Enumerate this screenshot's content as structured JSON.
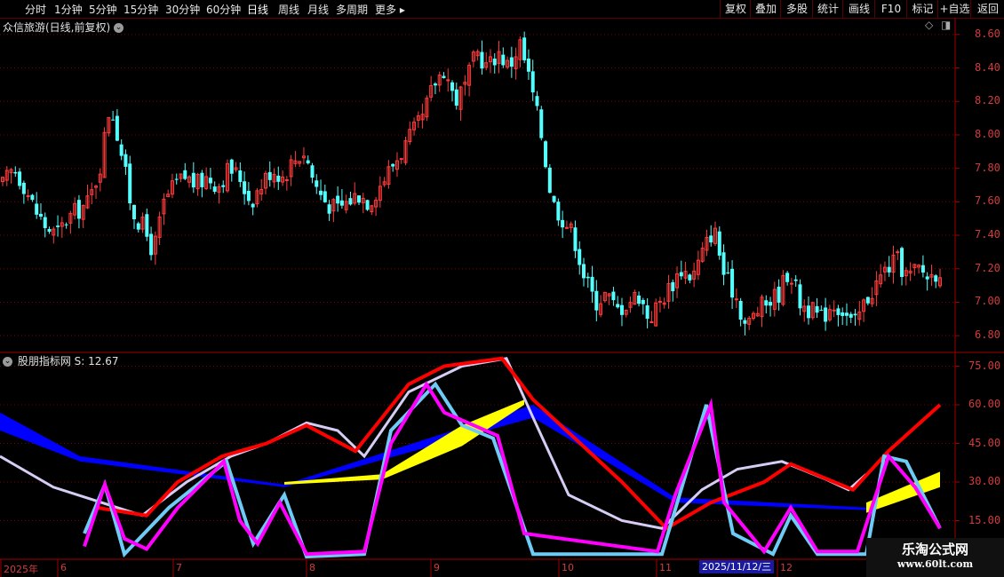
{
  "toolbar": {
    "periods": [
      "分时",
      "1分钟",
      "5分钟",
      "15分钟",
      "30分钟",
      "60分钟",
      "日线",
      "周线",
      "月线",
      "多周期",
      "更多"
    ],
    "active_period": "日线",
    "right_buttons": [
      "复权",
      "叠加",
      "多股",
      "统计",
      "画线",
      "F10",
      "标记",
      "+自选",
      "返回"
    ]
  },
  "main_panel": {
    "title": "众信旅游(日线,前复权)",
    "y_labels": [
      "8.60",
      "8.40",
      "8.20",
      "8.00",
      "7.80",
      "7.60",
      "7.40",
      "7.20",
      "7.00",
      "6.80"
    ],
    "icons": [
      "dropdown-icon",
      "diamond-icon",
      "window-toggle-icon"
    ]
  },
  "indicator_panel": {
    "title": "股朋指标网",
    "value_label": "S: 12.67",
    "y_labels": [
      "75.00",
      "60.00",
      "45.00",
      "30.00",
      "15.00"
    ]
  },
  "x_axis": {
    "labels": [
      "2025年",
      "6",
      "7",
      "8",
      "9",
      "10",
      "11",
      "12"
    ],
    "cursor_date": "2025/11/12/三"
  },
  "watermark": {
    "line1": "乐淘公式网",
    "line2": "www.60lt.com"
  },
  "colors": {
    "up": "#ff3c3c",
    "down": "#54ffff",
    "grid": "#7a0000",
    "magenta": "#ff00ff",
    "lightblue": "#6ecbf5",
    "red": "#ff0000",
    "lavender": "#d6cdf5",
    "blue": "#0000ff",
    "yellow": "#ffff00"
  },
  "chart_data": {
    "type": "candlestick",
    "price_ylim": [
      6.7,
      8.7
    ],
    "indicator_ylim": [
      0,
      80
    ],
    "close_path": [
      7.7,
      7.8,
      7.7,
      7.55,
      7.45,
      7.4,
      7.5,
      7.55,
      7.6,
      7.8,
      8.2,
      7.9,
      7.55,
      7.45,
      7.3,
      7.6,
      7.7,
      7.75,
      7.7,
      7.75,
      7.7,
      7.8,
      7.75,
      7.6,
      7.7,
      7.8,
      7.75,
      7.85,
      7.9,
      7.7,
      7.6,
      7.55,
      7.6,
      7.65,
      7.6,
      7.7,
      7.8,
      7.9,
      8.0,
      8.1,
      8.3,
      8.4,
      8.2,
      8.3,
      8.5,
      8.4,
      8.5,
      8.4,
      8.55,
      8.3,
      8.0,
      7.6,
      7.5,
      7.4,
      7.15,
      7.0,
      7.05,
      6.95,
      7.0,
      7.05,
      6.9,
      7.0,
      7.1,
      7.2,
      7.15,
      7.3,
      7.45,
      7.15,
      7.05,
      6.85,
      6.95,
      7.0,
      7.05,
      7.2,
      7.0,
      6.95,
      6.9,
      7.0,
      6.95,
      6.85,
      7.0,
      7.1,
      7.2,
      7.25,
      7.15,
      7.2,
      7.15,
      7.2
    ],
    "indicator_series": [
      {
        "name": "magenta"
      },
      {
        "name": "lightblue"
      },
      {
        "name": "red"
      },
      {
        "name": "lavender"
      },
      {
        "name": "blue"
      },
      {
        "name": "yellow"
      }
    ]
  }
}
